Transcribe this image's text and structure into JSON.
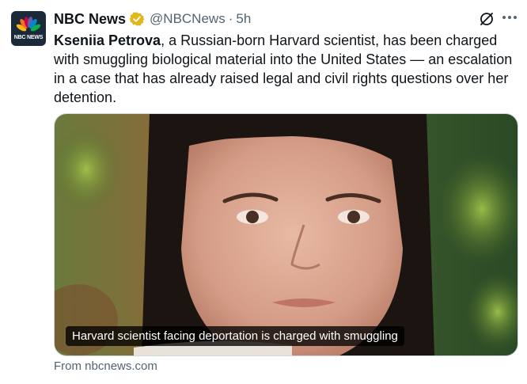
{
  "author": {
    "avatar_text": "NBC NEWS",
    "display_name": "NBC News",
    "handle": "@NBCNews",
    "separator": "·",
    "time": "5h",
    "verified_color": "#e2b719"
  },
  "tweet": {
    "bold_name": "Kseniia Petrova",
    "body": ", a Russian-born Harvard scientist, has been charged with smuggling biological material into the United States — an escalation in a case that has already raised legal and civil rights questions over her detention."
  },
  "card": {
    "caption": "Harvard scientist facing deportation is charged with smuggling",
    "source": "From nbcnews.com"
  },
  "icons": {
    "grok": "grok-icon",
    "more": "more-icon",
    "verified": "verified-badge-icon"
  },
  "colors": {
    "text": "#0f1419",
    "secondary": "#536471"
  }
}
